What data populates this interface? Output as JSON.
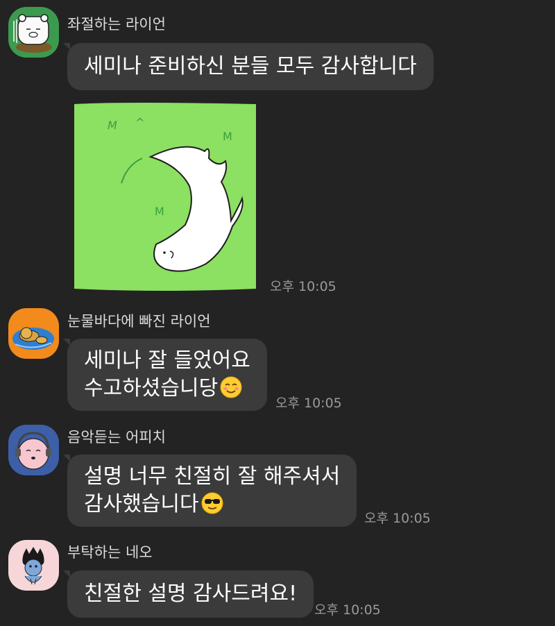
{
  "messages": [
    {
      "sender": "좌절하는 라이언",
      "avatar_icon": "lion-frustrated-avatar-icon",
      "bubbles": [
        {
          "lines": [
            "세미나 준비하신 분들 모두 감사합니다"
          ]
        }
      ],
      "sticker": "otter-sticker",
      "time": "오후 10:05"
    },
    {
      "sender": "눈물바다에 빠진 라이언",
      "avatar_icon": "lion-tears-avatar-icon",
      "bubbles": [
        {
          "lines": [
            "세미나 잘 들었어요",
            "수고하셨습니당"
          ],
          "emoji": "smiling-blush-emoji"
        }
      ],
      "time": "오후 10:05"
    },
    {
      "sender": "음악듣는 어피치",
      "avatar_icon": "apeach-headphones-avatar-icon",
      "bubbles": [
        {
          "lines": [
            "설명 너무 친절히 잘 해주셔서",
            "감사했습니다"
          ],
          "emoji": "sunglasses-emoji"
        }
      ],
      "time": "오후 10:05"
    },
    {
      "sender": "부탁하는 네오",
      "avatar_icon": "neo-begging-avatar-icon",
      "bubbles": [
        {
          "lines": [
            "친절한 설명 감사드려요!"
          ]
        }
      ],
      "time": "오후 10:05"
    }
  ],
  "colors": {
    "background": "#232323",
    "bubble": "#3b3b3b",
    "sender_text": "#dcdcdc",
    "time_text": "#9a9a9a",
    "sticker_green": "#8ce062"
  }
}
